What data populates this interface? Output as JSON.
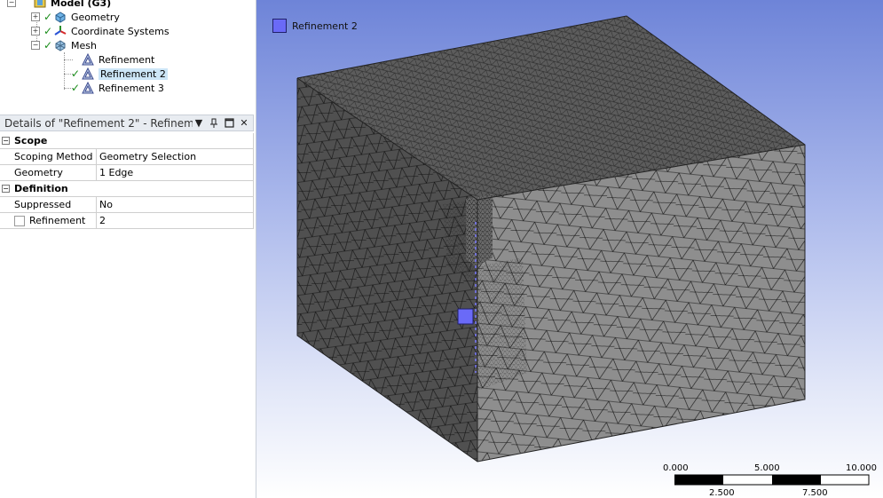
{
  "tree": {
    "model_label": "Model (G3)",
    "items": [
      {
        "label": "Geometry"
      },
      {
        "label": "Coordinate Systems"
      },
      {
        "label": "Mesh"
      }
    ],
    "mesh_children": [
      {
        "label": "Refinement"
      },
      {
        "label": "Refinement 2"
      },
      {
        "label": "Refinement 3"
      }
    ]
  },
  "details": {
    "title": "Details of \"Refinement 2\" - Refineme",
    "sections": [
      {
        "name": "Scope",
        "rows": [
          {
            "key": "Scoping Method",
            "value": "Geometry Selection"
          },
          {
            "key": "Geometry",
            "value": "1 Edge"
          }
        ]
      },
      {
        "name": "Definition",
        "rows": [
          {
            "key": "Suppressed",
            "value": "No"
          },
          {
            "key": "Refinement",
            "value": "2"
          }
        ]
      }
    ]
  },
  "viewport": {
    "legend_label": "Refinement 2",
    "legend_color": "#6a6af7",
    "scale_labels": [
      "0.000",
      "5.000",
      "10.000",
      "2.500",
      "7.500"
    ]
  }
}
